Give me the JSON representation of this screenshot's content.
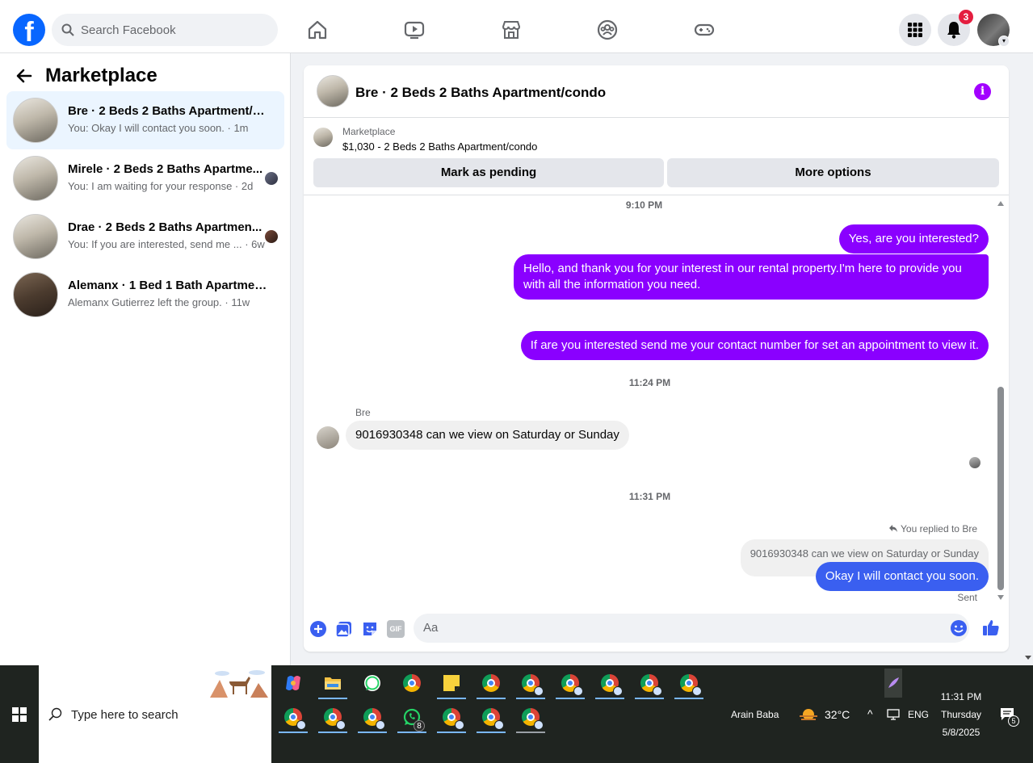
{
  "topnav": {
    "logo_letter": "f",
    "search_placeholder": "Search Facebook",
    "notifications_count": "3"
  },
  "sidebar": {
    "title": "Marketplace",
    "conversations": [
      {
        "title": "Bre · 2 Beds 2 Baths Apartment/co...",
        "subtitle": "You: Okay I will contact you soon. · 1m",
        "active": true
      },
      {
        "title": "Mirele · 2 Beds 2 Baths Apartme...",
        "subtitle": "You: I am waiting for your response · 2d",
        "active": false
      },
      {
        "title": "Drae · 2 Beds 2 Baths Apartmen...",
        "subtitle": "You: If you are interested, send me ... · 6w",
        "active": false
      },
      {
        "title": "Alemanx · 1 Bed 1 Bath Apartment...",
        "subtitle": "Alemanx Gutierrez left the group. · 11w",
        "active": false
      }
    ]
  },
  "chat": {
    "title": "Bre · 2 Beds 2 Baths Apartment/condo",
    "info_icon_glyph": "i",
    "listing": {
      "label": "Marketplace",
      "price_line": "$1,030 - 2 Beds 2 Baths Apartment/condo",
      "mark_pending": "Mark as pending",
      "more_options": "More options"
    },
    "time1": "9:10 PM",
    "msg1": "Yes, are you interested?",
    "msg2": "Hello, and thank you for your interest in our rental property.I'm here to provide you with all the information you need.",
    "msg3": "If are you interested send me your contact number for set an appointment to view it.",
    "time2": "11:24 PM",
    "sender": "Bre",
    "msg4": "9016930348 can we view on Saturday or Sunday",
    "time3": "11:31 PM",
    "replied_label": "You replied to Bre",
    "reply_quote": "9016930348 can we view on Saturday or Sunday",
    "msg5": "Okay I will contact you soon.",
    "sent_label": "Sent",
    "input_placeholder": "Aa",
    "gif_label": "GIF"
  },
  "taskbar": {
    "search_placeholder": "Type here to search",
    "whatsapp_badge": "8",
    "user_label": "Arain Baba",
    "temperature": "32°C",
    "language": "ENG",
    "time": "11:31 PM",
    "day": "Thursday",
    "date": "5/8/2025",
    "notif_count": "5"
  },
  "colors": {
    "fb_blue": "#0866ff",
    "purple_bubble": "#8a00ff",
    "blue_bubble": "#3a5ff0",
    "taskbar": "#1f2420"
  }
}
